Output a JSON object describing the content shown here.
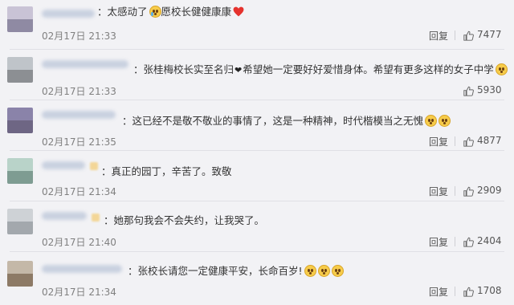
{
  "comments": [
    {
      "text": "太感动了",
      "text2": "愿校长健健康康",
      "time": "02月17日 21:33",
      "reply": "回复",
      "likes": "7477",
      "avatar_colors": [
        "#c9c3d6",
        "#8f8aa3"
      ]
    },
    {
      "text": "张桂梅校长实至名归",
      "text2": "希望她一定要好好爱惜身体。希望有更多这样的女子中学",
      "time": "02月17日 21:33",
      "reply": "回复",
      "likes": "5930",
      "avatar_colors": [
        "#bfc4c9",
        "#8c8f93"
      ]
    },
    {
      "text": "这已经不是敬不敬业的事情了，这是一种精神，时代楷模当之无愧",
      "time": "02月17日 21:35",
      "reply": "回复",
      "likes": "4877",
      "avatar_colors": [
        "#8a83a9",
        "#6e6684"
      ]
    },
    {
      "text": "真正的园丁，辛苦了。致敬",
      "time": "02月17日 21:34",
      "reply": "回复",
      "likes": "2909",
      "avatar_colors": [
        "#b9d3c9",
        "#7e9c92"
      ]
    },
    {
      "text": "她那句我会不会失约，让我哭了。",
      "time": "02月17日 21:40",
      "reply": "回复",
      "likes": "2404",
      "avatar_colors": [
        "#ced2d6",
        "#a3a8ad"
      ]
    },
    {
      "text": "张校长请您一定健康平安，长命百岁!",
      "time": "02月17日 21:34",
      "reply": "回复",
      "likes": "1708",
      "avatar_colors": [
        "#c4b8a8",
        "#8d7a66"
      ]
    }
  ],
  "colors": {
    "background": "#f2f2f5",
    "divider": "#e0e0e5",
    "timestamp": "#808080",
    "heart": "#e5322d"
  },
  "icons": [
    "thumbs-up-icon",
    "crying-emoji-icon",
    "red-heart-icon",
    "black-heart-icon",
    "pleading-emoji-icon"
  ]
}
